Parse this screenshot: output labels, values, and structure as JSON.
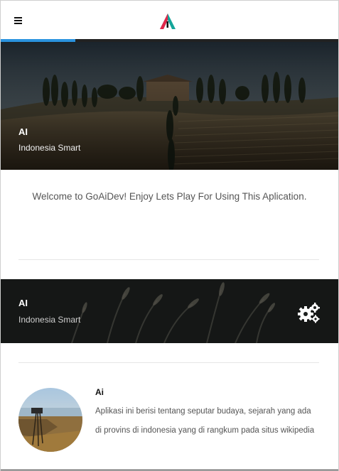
{
  "header": {
    "menu_icon": "hamburger-menu-icon",
    "logo_icon": "triangle-a-logo",
    "progress_percent": 22,
    "colors": {
      "progress": "#2b93df",
      "logo_red": "#e2274a",
      "logo_teal": "#14a59a"
    }
  },
  "hero": {
    "title": "AI",
    "subtitle": "Indonesia Smart"
  },
  "welcome": {
    "text": "Welcome to GoAiDev! Enjoy Lets Play For Using This Aplication."
  },
  "band": {
    "title": "AI",
    "subtitle": "Indonesia Smart",
    "action_icon": "gears-icon"
  },
  "info": {
    "title": "Ai",
    "line1": "Aplikasi ini berisi tentang seputar budaya, sejarah yang ada",
    "line2": "di provins di indonesia yang di rangkum pada situs wikipedia"
  }
}
